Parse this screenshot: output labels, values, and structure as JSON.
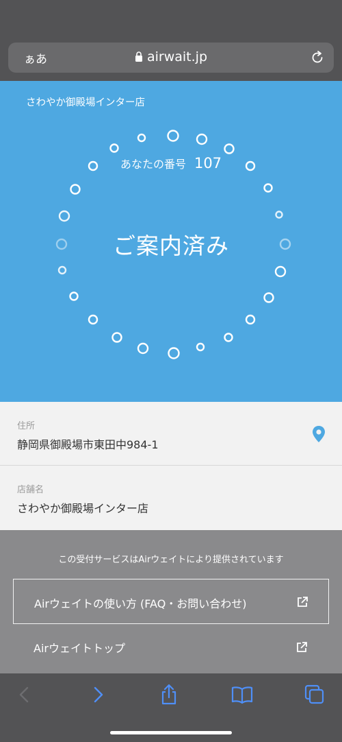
{
  "browser": {
    "text_size_label": "ぁあ",
    "url": "airwait.jp"
  },
  "hero": {
    "store_title": "さわやか御殿場インター店",
    "number_label": "あなたの番号",
    "number_value": "107",
    "status": "ご案内済み"
  },
  "info": {
    "address_label": "住所",
    "address_value": "静岡県御殿場市東田中984-1",
    "store_label": "店舗名",
    "store_value": "さわやか御殿場インター店"
  },
  "footer": {
    "provided_text": "この受付サービスはAirウェイトにより提供されています",
    "how_to_link": "Airウェイトの使い方 (FAQ・お問い合わせ)",
    "top_link": "Airウェイトトップ"
  },
  "colors": {
    "hero_bg": "#4ea8e1",
    "pin": "#4ea8e1",
    "toolbar_icon": "#4f8ff7"
  }
}
